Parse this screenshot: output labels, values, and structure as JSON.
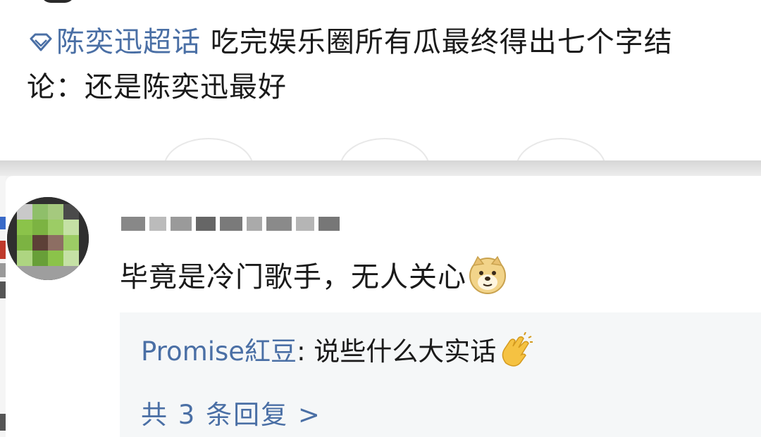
{
  "post": {
    "topic": "陈奕迅超话",
    "topic_icon": "topic-diamond-icon",
    "text_line1": " 吃完娱乐圈所有瓜最终得出七个字结",
    "text_line2": "论：还是陈奕迅最好"
  },
  "comment": {
    "username_redacted": true,
    "text": "毕竟是冷门歌手，无人关心",
    "emoji": "doge-icon",
    "reply": {
      "author": "Promise紅豆",
      "separator": ": ",
      "text": "说些什么大实话",
      "emoji": "clap-icon"
    },
    "more_replies_label": "共 3 条回复 >"
  },
  "colors": {
    "link": "#4a6fa5",
    "text": "#1a1a1a",
    "reply_background": "#f5f7f8",
    "divider": "#d6d6d6"
  }
}
